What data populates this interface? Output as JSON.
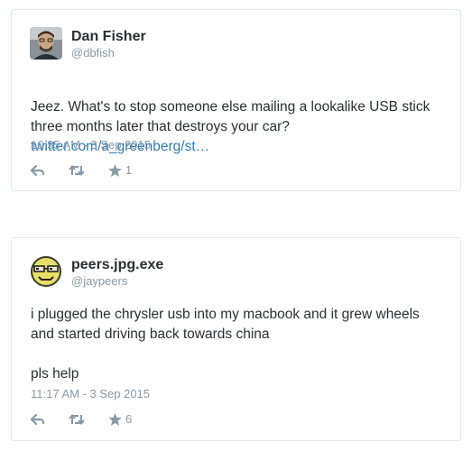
{
  "tweets": [
    {
      "author_name": "Dan Fisher",
      "author_handle": "@dbfish",
      "text": "Jeez. What's to stop someone else mailing a lookalike USB stick three months later that destroys your car?",
      "link": "twitter.com/a_greenberg/st…",
      "timestamp": "10:35 AM - 3 Sep 2015",
      "favorite_count": "1",
      "avatar_icon": "person-photo-icon"
    },
    {
      "author_name": "peers.jpg.exe",
      "author_handle": "@jaypeers",
      "text": "i plugged the chrysler usb into my macbook and it grew wheels and started driving back towards china\n\npls help",
      "timestamp": "11:17 AM - 3 Sep 2015",
      "favorite_count": "6",
      "avatar_icon": "pixel-smiley-sunglasses-icon"
    }
  ],
  "colors": {
    "border": "#e1e8ed",
    "name": "#292f33",
    "muted": "#8899a6",
    "link": "#2b7bb9"
  },
  "icons": {
    "reply": "reply-icon",
    "retweet": "retweet-icon",
    "favorite": "star-icon"
  }
}
